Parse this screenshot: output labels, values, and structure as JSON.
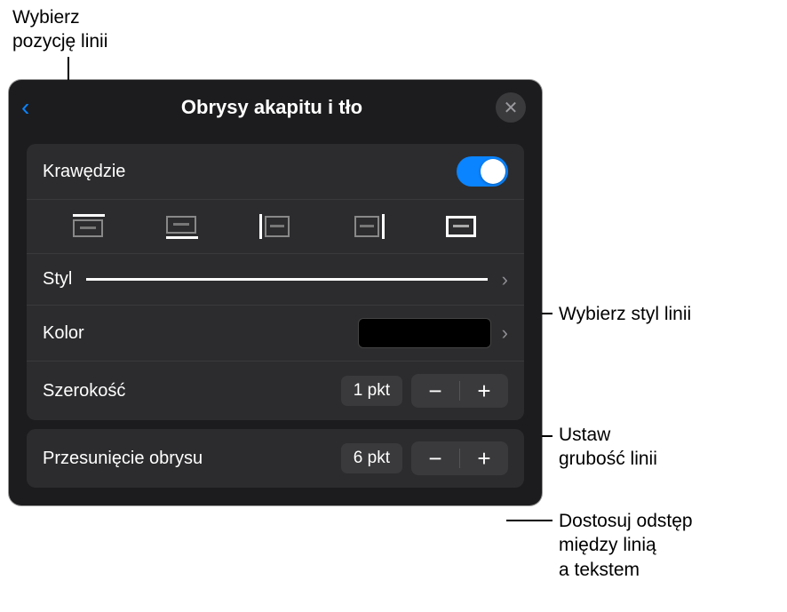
{
  "callouts": {
    "position": "Wybierz\npozycję linii",
    "style": "Wybierz styl linii",
    "width": "Ustaw\ngrubość linii",
    "offset": "Dostosuj odstęp\nmiędzy linią\na tekstem"
  },
  "panel": {
    "title": "Obrysy akapitu i tło"
  },
  "rows": {
    "borders_label": "Krawędzie",
    "style_label": "Styl",
    "color_label": "Kolor",
    "width_label": "Szerokość",
    "width_value": "1 pkt",
    "offset_label": "Przesunięcie obrysu",
    "offset_value": "6 pkt"
  },
  "glyphs": {
    "minus": "−",
    "plus": "+",
    "chevron": "›",
    "close": "✕",
    "back": "‹"
  }
}
